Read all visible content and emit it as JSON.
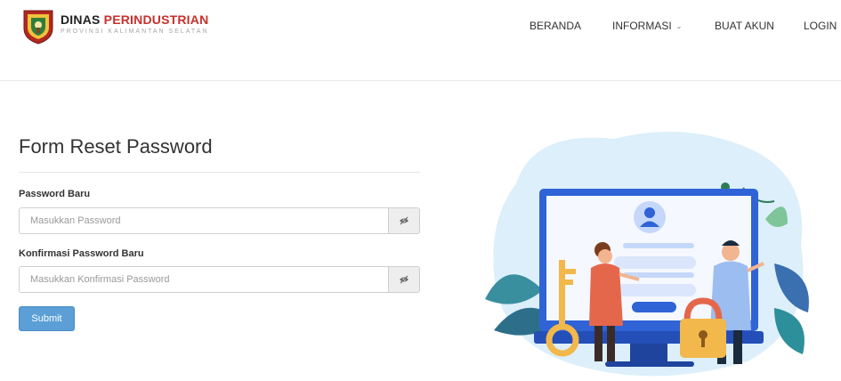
{
  "header": {
    "brand_name_part1": "DINAS ",
    "brand_name_part2": "PERINDUSTRIAN",
    "brand_subtitle": "PROVINSI KALIMANTAN SELATAN",
    "nav": {
      "home": "BERANDA",
      "info": "INFORMASI",
      "signup": "BUAT AKUN",
      "login": "LOGIN"
    }
  },
  "form": {
    "title": "Form Reset Password",
    "new_password_label": "Password Baru",
    "new_password_placeholder": "Masukkan Password",
    "confirm_label": "Konfirmasi Password Baru",
    "confirm_placeholder": "Masukkan Konfirmasi Password",
    "submit_label": "Submit"
  },
  "colors": {
    "brand_red": "#c9302c",
    "submit_blue": "#5b9fd6"
  }
}
